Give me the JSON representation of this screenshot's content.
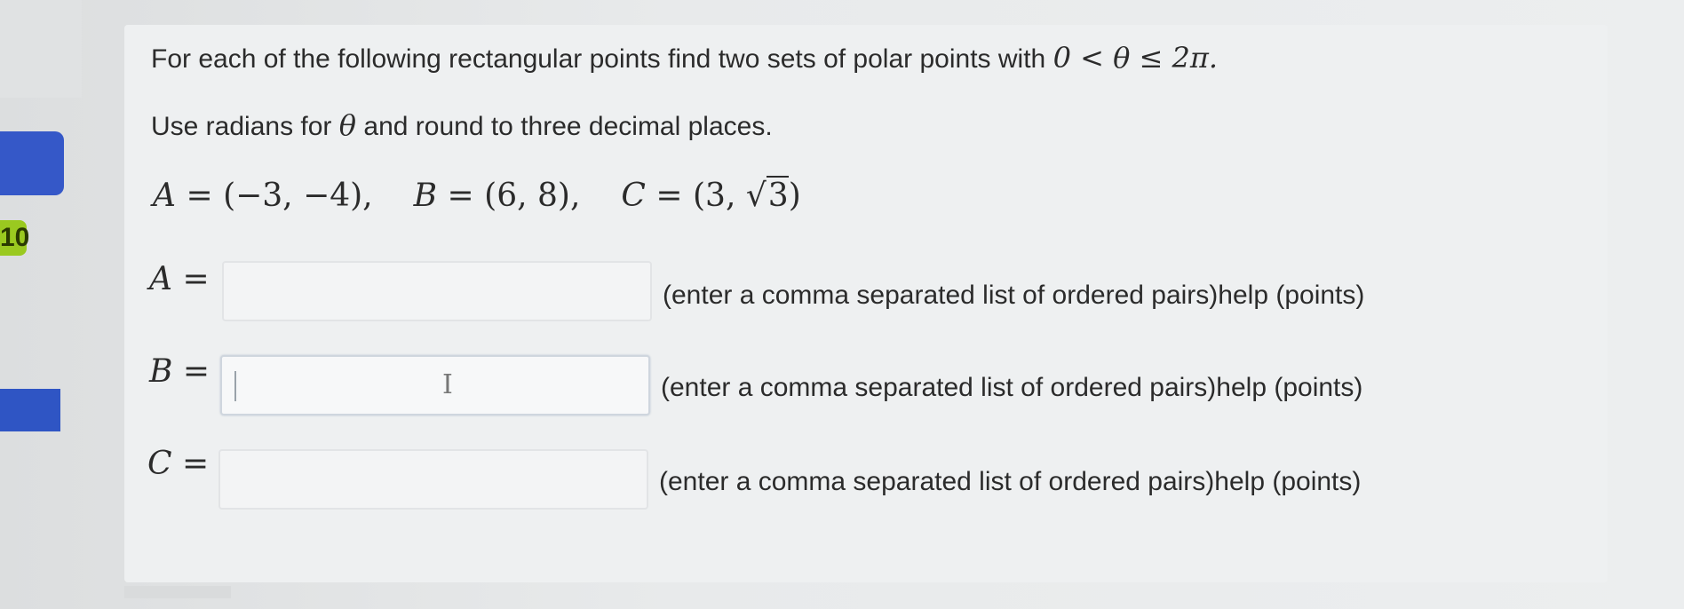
{
  "problem": {
    "intro_text": "For each of the following rectangular points find two sets of polar points with",
    "intro_condition": "0 < θ ≤ 2π.",
    "instruction_prefix": "Use radians for",
    "instruction_theta": "θ",
    "instruction_suffix": "and round to three decimal places.",
    "points": [
      {
        "label": "A",
        "value": "(−3, −4),"
      },
      {
        "label": "B",
        "value": "(6, 8),"
      },
      {
        "label": "C",
        "value_prefix": "(3, ",
        "sqrt_arg": "3",
        "value_suffix": ")"
      }
    ]
  },
  "answers": [
    {
      "label": "A",
      "value": "",
      "hint": "(enter a comma separated list of ordered pairs)help (points)"
    },
    {
      "label": "B",
      "value": "",
      "hint": "(enter a comma separated list of ordered pairs)help (points)"
    },
    {
      "label": "C",
      "value": "",
      "hint": "(enter a comma separated list of ordered pairs)help (points)"
    }
  ],
  "sidebar": {
    "badge_text": "10"
  },
  "colors": {
    "accent_blue": "#3558c8",
    "badge_green": "#9ac920"
  }
}
